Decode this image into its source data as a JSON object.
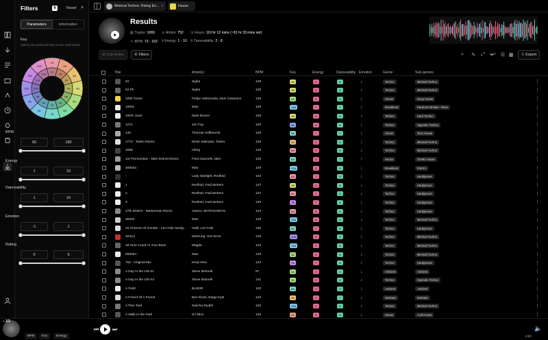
{
  "rail": {
    "icons": [
      "library-icon",
      "import-icon",
      "playlist-icon",
      "crate-icon",
      "graph-icon",
      "history-icon",
      "settings-icon",
      "stack-icon",
      "download-icon",
      "user-icon"
    ]
  },
  "filters": {
    "title": "Filters",
    "count": "6",
    "reset": "Reset",
    "close": "×",
    "tabs": [
      "Parameters",
      "Information"
    ],
    "key_label": "Key",
    "key_help": "Select your preferred keys on the circle below",
    "wheel_outer": [
      "1B",
      "2B",
      "3B",
      "4B",
      "5B",
      "6B",
      "7B",
      "8B",
      "9B",
      "10B",
      "11B",
      "12B"
    ],
    "wheel_inner": [
      "1A",
      "2A",
      "3A",
      "4A",
      "5A",
      "6A",
      "7A",
      "8A",
      "9A",
      "10A",
      "11A",
      "12A"
    ],
    "bpm": {
      "label": "BPM",
      "min": "60",
      "max": "180"
    },
    "energy": {
      "label": "Energy",
      "min": "1",
      "max": "10"
    },
    "danceability": {
      "label": "Danceability",
      "min": "1",
      "max": "10"
    },
    "emotion": {
      "label": "Emotion",
      "min": "-1",
      "max": "1"
    },
    "rating": {
      "label": "Rating",
      "min": "0",
      "max": "5"
    }
  },
  "tabs": [
    {
      "label": "Minimal Techno: Rising En..."
    },
    {
      "label": "House"
    }
  ],
  "results": {
    "title": "Results",
    "tracks_label": "Tracks:",
    "tracks": "1069",
    "artists_label": "Artists:",
    "artists": "752",
    "hours_label": "Hours:",
    "hours": "110 hr 12 mins (~81 hr 33 mins set)",
    "bpm_label": "BPM:",
    "bpm": "73 - 153",
    "energy_label": "Energy:",
    "energy": "1 - 10",
    "dance_label": "Danceability:",
    "dance": "2 - 8",
    "sub_bmr": "Sub-Rules",
    "filters_btn": "Filters",
    "export": "Export"
  },
  "columns": {
    "title": "Title",
    "artists": "Artist(s)",
    "bpm": "BPM",
    "key": "Key",
    "energy": "Energy",
    "dance": "Danceability",
    "emotion": "Emotion",
    "genre": "Genre",
    "subgenres": "Sub-genres"
  },
  "colors": {
    "accent": "#ffffff",
    "key_wheel": [
      "#e89aa8",
      "#e9a07f",
      "#e8c173",
      "#d8db74",
      "#a8dc7e",
      "#7fdba2",
      "#79d7c9",
      "#7cc4e5",
      "#8aa4ea",
      "#a18ee8",
      "#c38ae3",
      "#de8fc8"
    ]
  },
  "rows": [
    {
      "title": "04",
      "artist": "Sigha",
      "bpm": "128",
      "key": "4A",
      "keyc": "#d8db74",
      "energy": "5",
      "dance": "6",
      "emo": "down",
      "genre": "Techno",
      "sub": "Minimal Techno"
    },
    {
      "title": "04 Pk",
      "artist": "Sigha",
      "bpm": "128",
      "key": "4B",
      "keyc": "#d8db74",
      "energy": "6",
      "dance": "6",
      "emo": "down",
      "genre": "Techno",
      "sub": "Minimal Techno"
    },
    {
      "title": "1000 Tones",
      "artist": "Felipe Valenzuela,  Dani Casarano",
      "bpm": "125",
      "key": "5A",
      "keyc": "#a8dc7e",
      "energy": "4",
      "dance": "6",
      "emo": "down",
      "genre": "House",
      "sub": "Deep House"
    },
    {
      "title": "10001",
      "artist": "Wax",
      "bpm": "128",
      "key": "12A",
      "keyc": "#7cc4e5",
      "energy": "7",
      "dance": "7",
      "emo": "down",
      "genre": "Breakbeat",
      "sub": "Hardcore Breaks - Rave"
    },
    {
      "title": "100% Juice",
      "artist": "Mark Broom",
      "bpm": "129",
      "key": "4A",
      "keyc": "#d8db74",
      "energy": "6",
      "dance": "6",
      "emo": "down",
      "genre": "Techno",
      "sub": "Hard Techno"
    },
    {
      "title": "1271",
      "artist": "Jon Fay",
      "bpm": "120",
      "key": "9A",
      "keyc": "#8aa4ea",
      "energy": "4",
      "dance": "6",
      "emo": "down",
      "genre": "Techno",
      "sub": "Hypnotic Techno"
    },
    {
      "title": "130",
      "artist": "Thomas Hoffknecht",
      "bpm": "129",
      "key": "8A",
      "keyc": "#79d7c9",
      "energy": "7",
      "dance": "7",
      "emo": "down",
      "genre": "House",
      "sub": "Tech House"
    },
    {
      "title": "1772 - Tadeo Remix",
      "artist": "Mosé Salmassi,  Tadeo",
      "bpm": "128",
      "key": "3A",
      "keyc": "#e8c173",
      "energy": "6",
      "dance": "6",
      "emo": "down",
      "genre": "Techno",
      "sub": "Minimal Techno"
    },
    {
      "title": "1999",
      "artist": "nthng",
      "bpm": "129",
      "key": "6A",
      "keyc": "#e89aa8",
      "energy": "6",
      "dance": "6",
      "emo": "down",
      "genre": "Techno",
      "sub": "Minimal Techno"
    },
    {
      "title": "1st Premonition - DBX Detroit Remix",
      "artist": "Fred Giannelli,  DBX",
      "bpm": "128",
      "key": "8A",
      "keyc": "#79d7c9",
      "energy": "6",
      "dance": "7",
      "emo": "up",
      "genre": "House",
      "sub": "Ghetto House"
    },
    {
      "title": "20003a",
      "artist": "Wax",
      "bpm": "129",
      "key": "12A",
      "keyc": "#7cc4e5",
      "energy": "5",
      "dance": "6",
      "emo": "down",
      "genre": "Breakbeat",
      "sub": "Electro"
    },
    {
      "title": "-",
      "artist": "Lady Starlight,  Redhōd",
      "bpm": "132",
      "key": "6A",
      "keyc": "#e89aa8",
      "energy": "7",
      "dance": "6",
      "emo": "down",
      "genre": "Techno",
      "sub": "Hardgroove"
    },
    {
      "title": "1",
      "artist": "Redhōd,  Fadi Mohem",
      "bpm": "137",
      "key": "4B",
      "keyc": "#d8db74",
      "energy": "6",
      "dance": "6",
      "emo": "down",
      "genre": "Techno",
      "sub": "Hardgroove"
    },
    {
      "title": "2",
      "artist": "Redhōd,  Fadi Mohem",
      "bpm": "137",
      "key": "6A",
      "keyc": "#e89aa8",
      "energy": "7",
      "dance": "6",
      "emo": "down",
      "genre": "Techno",
      "sub": "Hardgroove"
    },
    {
      "title": "3",
      "artist": "Redhōd,  Fadi Mohem",
      "bpm": "139",
      "key": "7B",
      "keyc": "#c38ae3",
      "energy": "7",
      "dance": "6",
      "emo": "down",
      "genre": "Techno",
      "sub": "Hardgroove"
    },
    {
      "title": "27th District - Markreman Remix",
      "artist": "Alarico,  MATRIXXMAN",
      "bpm": "144",
      "key": "6A",
      "keyc": "#e89aa8",
      "energy": "6",
      "dance": "6",
      "emo": "down",
      "genre": "Techno",
      "sub": "Hardgroove"
    },
    {
      "title": "30003",
      "artist": "Wax",
      "bpm": "129",
      "key": "12A",
      "keyc": "#7cc4e5",
      "energy": "6",
      "dance": "6",
      "emo": "down",
      "genre": "Techno",
      "sub": "Minimal Techno"
    },
    {
      "title": "34 Choices Of Gender - Len Faki Hardg...",
      "artist": "Irakli,  Len Faki",
      "bpm": "136",
      "key": "8A",
      "keyc": "#79d7c9",
      "energy": "7",
      "dance": "6",
      "emo": "down",
      "genre": "Techno",
      "sub": "Hardgroove"
    },
    {
      "title": "404(1)",
      "artist": "Warnung,  Son Error",
      "bpm": "125",
      "key": "10A",
      "keyc": "#a18ee8",
      "energy": "4",
      "dance": "5",
      "emo": "down",
      "genre": "Techno",
      "sub": "Minimal Techno"
    },
    {
      "title": "48 Hour Crack In Your Bass",
      "artist": "Magda",
      "bpm": "123",
      "key": "12A",
      "keyc": "#7cc4e5",
      "energy": "4",
      "dance": "6",
      "emo": "down",
      "genre": "Techno",
      "sub": "Minimal Techno"
    },
    {
      "title": "50005A",
      "artist": "Wax",
      "bpm": "129",
      "key": "5A",
      "keyc": "#a8dc7e",
      "energy": "5",
      "dance": "6",
      "emo": "down",
      "genre": "Techno",
      "sub": "Minimal Techno"
    },
    {
      "title": "752 - Original Mix",
      "artist": "Kenji Hina",
      "bpm": "143",
      "key": "7A",
      "keyc": "#c38ae3",
      "energy": "7",
      "dance": "6",
      "emo": "down",
      "genre": "Techno",
      "sub": "Hardgroove"
    },
    {
      "title": "A Day In the Life 01",
      "artist": "Steve Bicknell",
      "bpm": "97",
      "key": "5A",
      "keyc": "#a8dc7e",
      "energy": "3",
      "dance": "3",
      "emo": "down",
      "genre": "Ambient",
      "sub": "Ambient"
    },
    {
      "title": "A Day In the Life 03",
      "artist": "Steve Bicknell",
      "bpm": "131",
      "key": "5A",
      "keyc": "#a8dc7e",
      "energy": "6",
      "dance": "6",
      "emo": "down",
      "genre": "Techno",
      "sub": "Hypnotic Techno"
    },
    {
      "title": "A Field",
      "artist": "BLNDR",
      "bpm": "120",
      "key": "8A",
      "keyc": "#79d7c9",
      "energy": "3",
      "dance": "3",
      "emo": "down",
      "genre": "Ambient",
      "sub": "Ambient"
    },
    {
      "title": "A Friend Of A Friend",
      "artist": "Ben Klock,  Etapp Kyle",
      "bpm": "123",
      "key": "3A",
      "keyc": "#e8c173",
      "energy": "4",
      "dance": "7",
      "emo": "down",
      "genre": "Dubstep",
      "sub": "Dubstep"
    },
    {
      "title": "A Plus Tard",
      "artist": "Sascha Rydell",
      "bpm": "126",
      "key": "12A",
      "keyc": "#7cc4e5",
      "energy": "6",
      "dance": "6",
      "emo": "down",
      "genre": "Techno",
      "sub": "Minimal Techno"
    },
    {
      "title": "A Walk In the Park",
      "artist": "DJ Minx",
      "bpm": "125",
      "key": "2A",
      "keyc": "#e9a07f",
      "energy": "5",
      "dance": "6",
      "emo": "down",
      "genre": "House",
      "sub": "Acid House"
    }
  ],
  "player": {
    "now": "♪ 1/3",
    "tabs": [
      "BPM",
      "Key",
      "Energy"
    ],
    "time": "0:00"
  }
}
